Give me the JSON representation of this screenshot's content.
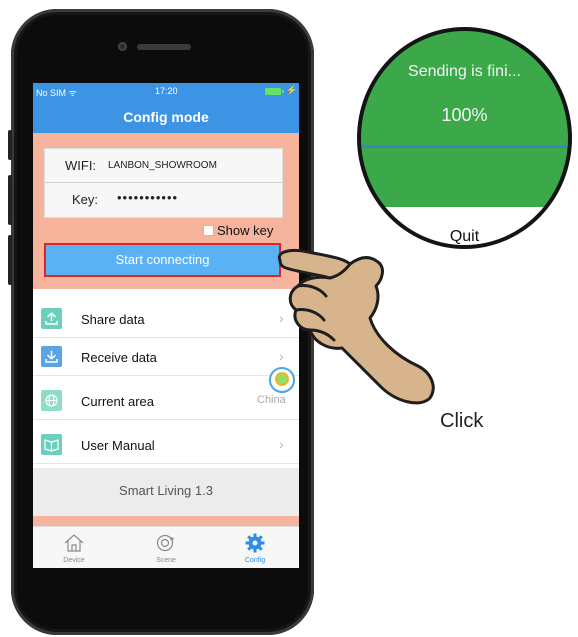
{
  "status": {
    "carrier": "No SIM ᯤ",
    "time": "17:20",
    "charging": "⚡"
  },
  "nav": {
    "title": "Config mode"
  },
  "config": {
    "wifi_label": "WIFI:",
    "wifi_value": "LANBON_SHOWROOM",
    "key_label": "Key:",
    "key_value": "•••••••••••",
    "show_key_label": "Show key",
    "start_button": "Start connecting"
  },
  "menu": [
    {
      "label": "Share data",
      "icon": "upload-icon",
      "chevron": "›"
    },
    {
      "label": "Receive data",
      "icon": "download-icon",
      "chevron": "›"
    },
    {
      "label": "Current area",
      "icon": "globe-icon",
      "value": "China"
    },
    {
      "label": "User Manual",
      "icon": "book-icon",
      "chevron": "›"
    }
  ],
  "footer": {
    "version": "Smart Living 1.3"
  },
  "tabs": [
    {
      "label": "Device",
      "icon": "home-icon"
    },
    {
      "label": "Scene",
      "icon": "scene-icon"
    },
    {
      "label": "Config",
      "icon": "gear-icon",
      "active": true
    }
  ],
  "zoom": {
    "title": "Sending is fini...",
    "percent": "100%",
    "quit": "Quit"
  },
  "annotation": {
    "click_label": "Click"
  },
  "colors": {
    "nav_blue": "#3e94e4",
    "peach": "#f7b49d",
    "button_blue": "#5ab1f4",
    "button_border": "#d7272b",
    "zoom_green": "#3ba94a",
    "icon_teal": "#6ccfbd",
    "icon_blue": "#5aa4e6",
    "active_tab": "#2f8de4"
  }
}
